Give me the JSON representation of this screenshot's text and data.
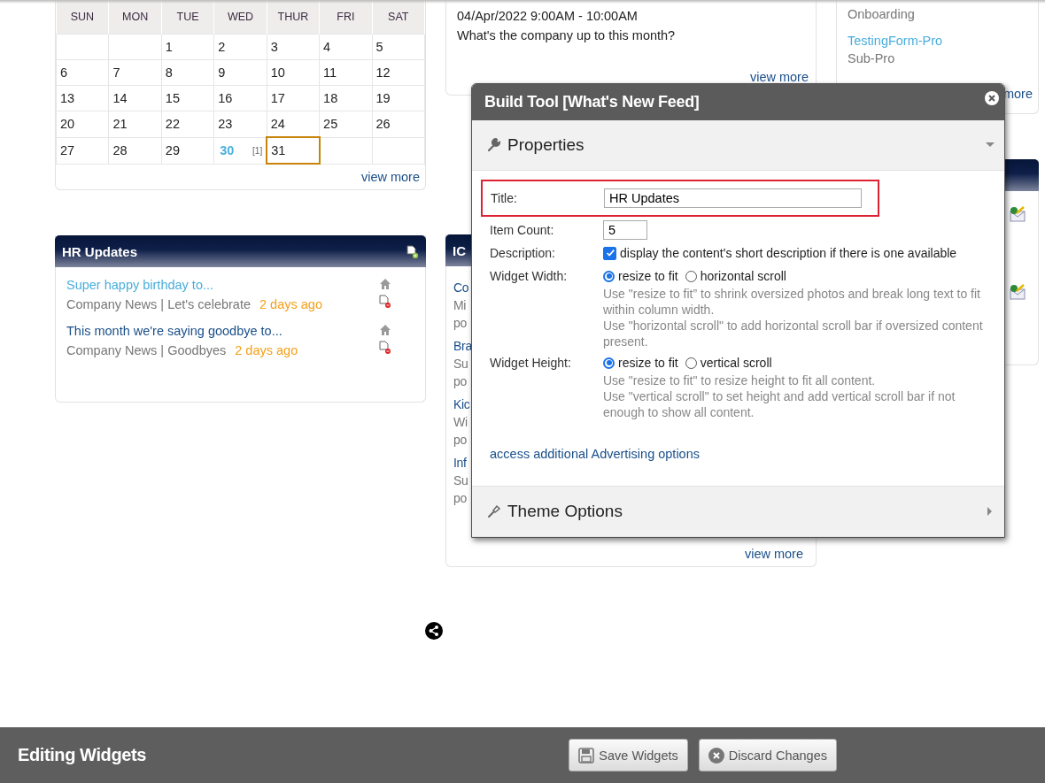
{
  "calendar": {
    "weekdays": [
      "SUN",
      "MON",
      "TUE",
      "WED",
      "THUR",
      "FRI",
      "SAT"
    ],
    "weeks": [
      [
        {
          "kind": "empty",
          "selected": false
        },
        {
          "kind": "empty",
          "selected": false
        },
        {
          "kind": "day",
          "day": "1",
          "selected": false
        },
        {
          "kind": "day",
          "day": "2",
          "selected": false
        },
        {
          "kind": "day",
          "day": "3",
          "selected": false
        },
        {
          "kind": "day",
          "day": "4",
          "selected": false
        },
        {
          "kind": "day",
          "day": "5",
          "selected": false
        }
      ],
      [
        {
          "kind": "day",
          "day": "6",
          "selected": false
        },
        {
          "kind": "day",
          "day": "7",
          "selected": false
        },
        {
          "kind": "day",
          "day": "8",
          "selected": false
        },
        {
          "kind": "day",
          "day": "9",
          "selected": false
        },
        {
          "kind": "day",
          "day": "10",
          "selected": false
        },
        {
          "kind": "day",
          "day": "11",
          "selected": false
        },
        {
          "kind": "day",
          "day": "12",
          "selected": false
        }
      ],
      [
        {
          "kind": "day",
          "day": "13",
          "selected": false
        },
        {
          "kind": "day",
          "day": "14",
          "selected": false
        },
        {
          "kind": "day",
          "day": "15",
          "selected": false
        },
        {
          "kind": "day",
          "day": "16",
          "selected": false
        },
        {
          "kind": "day",
          "day": "17",
          "selected": false
        },
        {
          "kind": "day",
          "day": "18",
          "selected": false
        },
        {
          "kind": "day",
          "day": "19",
          "selected": false
        }
      ],
      [
        {
          "kind": "day",
          "day": "20",
          "selected": false
        },
        {
          "kind": "day",
          "day": "21",
          "selected": false
        },
        {
          "kind": "day",
          "day": "22",
          "selected": false
        },
        {
          "kind": "day",
          "day": "23",
          "selected": false
        },
        {
          "kind": "day",
          "day": "24",
          "selected": false
        },
        {
          "kind": "day",
          "day": "25",
          "selected": false
        },
        {
          "kind": "day",
          "day": "26",
          "selected": false
        }
      ],
      [
        {
          "kind": "day",
          "day": "27",
          "selected": false
        },
        {
          "kind": "day",
          "day": "28",
          "selected": false
        },
        {
          "kind": "day",
          "day": "29",
          "selected": false
        },
        {
          "kind": "event",
          "day": "30",
          "count": "[1]",
          "selected": false
        },
        {
          "kind": "day",
          "day": "31",
          "selected": true
        },
        {
          "kind": "empty",
          "selected": false
        },
        {
          "kind": "empty",
          "selected": false
        }
      ]
    ],
    "view_more": "view more"
  },
  "hr_updates": {
    "title": "HR Updates",
    "items": [
      {
        "title": "Super happy birthday to...",
        "visited": true,
        "meta": "Company News | Let's celebrate",
        "time": "2 days ago"
      },
      {
        "title": "This month we're saying goodbye to...",
        "visited": false,
        "meta": "Company News | Goodbyes",
        "time": "2 days ago"
      }
    ]
  },
  "event": {
    "date": "04/Apr/2022 9:00AM - 10:00AM",
    "text": "What's the company up to this month?",
    "view_more": "view more"
  },
  "ic_widget": {
    "title": "IC",
    "items": [
      {
        "title": "Co",
        "summary": "Mi",
        "byline": "po"
      },
      {
        "title": "Bra",
        "summary": "Su",
        "byline": "po"
      },
      {
        "title": "Kic",
        "summary": "Wi",
        "byline": "po"
      },
      {
        "title": "Inf",
        "summary": "Su",
        "byline": "po"
      }
    ],
    "view_more": "view more"
  },
  "forms": {
    "items": [
      {
        "category": "Onboarding"
      },
      {
        "title": "TestingForm-Pro",
        "category": "Sub-Pro"
      }
    ],
    "more": "more"
  },
  "dialog": {
    "title": "Build Tool [What's New Feed]",
    "sections": [
      {
        "title": "Properties",
        "expanded": true
      },
      {
        "title": "Theme Options",
        "expanded": false
      }
    ],
    "fields": [
      {
        "kind": "text",
        "label": "Title:",
        "value": "HR Updates",
        "highlighted": true
      },
      {
        "kind": "number",
        "label": "Item Count:",
        "value": "5",
        "highlighted": false
      },
      {
        "kind": "checkbox",
        "label": "Description:",
        "checked": true,
        "text": "display the content's short description if there is one available"
      },
      {
        "kind": "radio",
        "label": "Widget Width:",
        "options": [
          {
            "label": "resize to fit",
            "selected": true
          },
          {
            "label": "horizontal scroll",
            "selected": false
          }
        ],
        "help": [
          "Use \"resize to fit” to shrink oversized photos and break long text to fit within column width.",
          "Use \"horizontal scroll\" to add horizontal scroll bar if oversized content present."
        ]
      },
      {
        "kind": "radio",
        "label": "Widget Height:",
        "options": [
          {
            "label": "resize to fit",
            "selected": true
          },
          {
            "label": "vertical scroll",
            "selected": false
          }
        ],
        "help": [
          "Use \"resize to fit\" to resize height to fit all content.",
          "Use \"vertical scroll\" to set height and add vertical scroll bar if not enough to show all content."
        ]
      }
    ],
    "link": "access additional Advertising options"
  },
  "footer": {
    "title": "Editing Widgets",
    "buttons": [
      {
        "kind": "save",
        "label": "Save Widgets"
      },
      {
        "kind": "discard",
        "label": "Discard Changes"
      }
    ]
  }
}
